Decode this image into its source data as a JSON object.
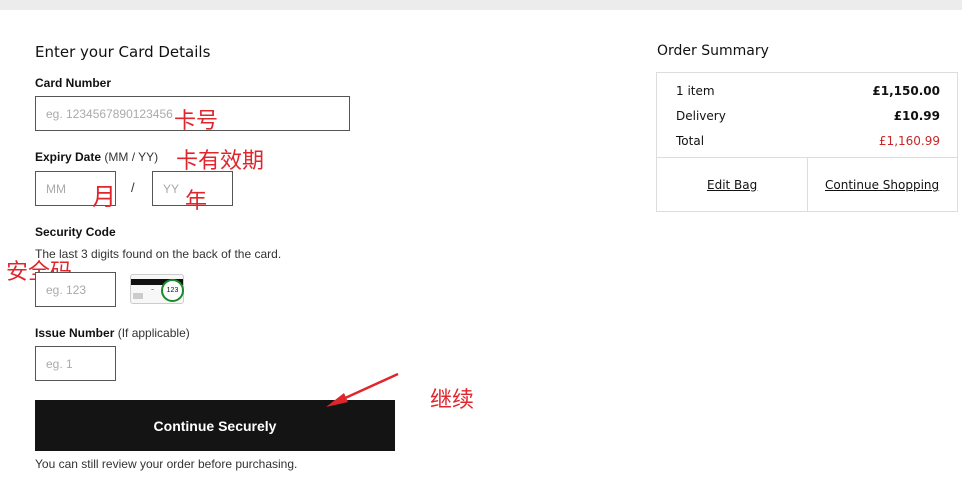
{
  "form": {
    "title": "Enter your Card Details",
    "card_number_label": "Card Number",
    "card_number_placeholder": "eg. 1234567890123456",
    "expiry_label": "Expiry Date",
    "expiry_hint": "(MM / YY)",
    "month_placeholder": "MM",
    "slash": "/",
    "year_placeholder": "YY",
    "security_label": "Security Code",
    "security_hint": "The last 3 digits found on the back of the card.",
    "security_placeholder": "eg. 123",
    "card_image_code": "123",
    "issue_label": "Issue Number",
    "issue_hint": "(If applicable)",
    "issue_placeholder": "eg. 1",
    "continue_label": "Continue Securely",
    "review_note": "You can still review your order before purchasing."
  },
  "annotations": {
    "card_number": "卡号",
    "expiry": "卡有效期",
    "month": "月",
    "year": "年",
    "security": "安全码",
    "continue": "继续"
  },
  "summary": {
    "title": "Order Summary",
    "rows": [
      {
        "label": "1 item",
        "value": "£1,150.00"
      },
      {
        "label": "Delivery",
        "value": "£10.99"
      },
      {
        "label": "Total",
        "value": "£1,160.99"
      }
    ],
    "edit_bag": "Edit Bag",
    "continue_shopping": "Continue Shopping"
  },
  "colors": {
    "annotation": "#e0262d",
    "total": "#c62828",
    "button": "#141414",
    "card_badge": "#1a8a2a"
  }
}
